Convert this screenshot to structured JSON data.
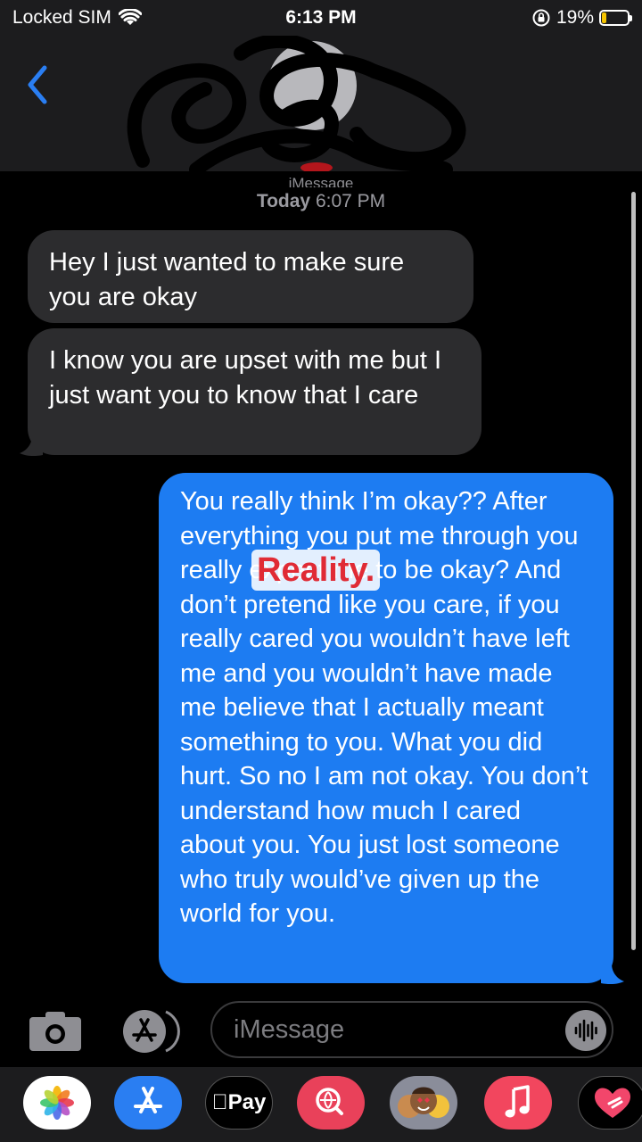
{
  "status_bar": {
    "carrier": "Locked SIM",
    "time": "6:13 PM",
    "battery": "19%",
    "battery_level": 0.19
  },
  "header": {
    "service_label": "iMessage"
  },
  "conversation": {
    "timestamp_day": "Today",
    "timestamp_time": "6:07 PM",
    "messages": [
      {
        "direction": "incoming",
        "text": "Hey I just wanted to make sure you are okay"
      },
      {
        "direction": "incoming",
        "text": "I know you are upset with me but I just want you to know that I care"
      },
      {
        "direction": "outgoing",
        "text": "You really think I’m okay?? After everything you put me through you really expect me to be okay? And don’t pretend like you care, if you really cared you wouldn’t have left me and you wouldn’t have made me believe that I actually meant something to you. What you did hurt. So no I am not okay. You don’t understand how much I cared about you. You just lost someone who truly would’ve given up the world for you."
      }
    ],
    "watermark": "Reality."
  },
  "input": {
    "placeholder": "iMessage"
  },
  "app_drawer": {
    "apple_pay_label": "Pay",
    "apps": [
      "photos-icon",
      "app-store-icon",
      "apple-pay-icon",
      "images-search-icon",
      "memoji-icon",
      "music-icon",
      "digital-touch-icon"
    ]
  },
  "colors": {
    "outgoing_bubble": "#1d7cf2",
    "incoming_bubble": "#2c2c2e",
    "accent": "#2a7ef2",
    "battery_fill": "#f5c400"
  }
}
